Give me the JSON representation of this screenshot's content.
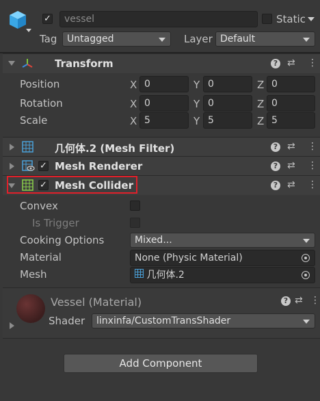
{
  "gameobject": {
    "active_checked": true,
    "name": "vessel",
    "static_label": "Static",
    "tag_label": "Tag",
    "tag_value": "Untagged",
    "layer_label": "Layer",
    "layer_value": "Default"
  },
  "transform": {
    "title": "Transform",
    "rows": [
      {
        "label": "Position",
        "x": "0",
        "y": "0",
        "z": "0"
      },
      {
        "label": "Rotation",
        "x": "0",
        "y": "0",
        "z": "0"
      },
      {
        "label": "Scale",
        "x": "5",
        "y": "5",
        "z": "5"
      }
    ],
    "axis_x": "X",
    "axis_y": "Y",
    "axis_z": "Z"
  },
  "mesh_filter": {
    "title": "几何体.2 (Mesh Filter)"
  },
  "mesh_renderer": {
    "title": "Mesh Renderer"
  },
  "mesh_collider": {
    "title": "Mesh Collider",
    "convex_label": "Convex",
    "is_trigger_label": "Is Trigger",
    "cooking_label": "Cooking Options",
    "cooking_value": "Mixed...",
    "material_label": "Material",
    "material_value": "None (Physic Material)",
    "mesh_label": "Mesh",
    "mesh_value": "几何体.2"
  },
  "material": {
    "title": "Vessel (Material)",
    "shader_label": "Shader",
    "shader_value": "linxinfa/CustomTransShader"
  },
  "add_component_label": "Add Component",
  "colors": {
    "highlight": "#e0202a",
    "background": "#383838",
    "header": "#3e3e3e"
  }
}
